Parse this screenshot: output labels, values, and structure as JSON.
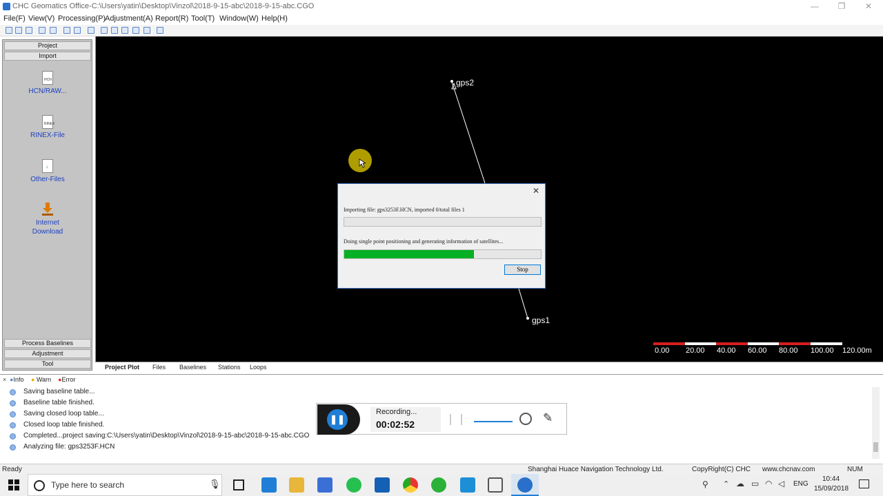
{
  "window": {
    "title": "CHC Geomatics Office-C:\\Users\\yatin\\Desktop\\Vinzol\\2018-9-15-abc\\2018-9-15-abc.CGO",
    "controls": {
      "minimize": "—",
      "maximize": "❐",
      "close": "✕"
    }
  },
  "menu": [
    "File(F)",
    "View(V)",
    "Processing(P)",
    "Adjustment(A)",
    "Report(R)",
    "Tool(T)",
    "Window(W)",
    "Help(H)"
  ],
  "left_panel": {
    "top_headers": [
      "Project",
      "Import"
    ],
    "items": [
      {
        "label": "HCN/RAW...",
        "tag": "HCN"
      },
      {
        "label": "RINEX-File",
        "tag": "RINEX"
      },
      {
        "label": "Other-Files",
        "tag": ""
      },
      {
        "label_line1": "Internet",
        "label_line2": "Download"
      }
    ],
    "bottom_headers": [
      "Process Baselines",
      "Adjustment",
      "Tool"
    ]
  },
  "map": {
    "stations": [
      {
        "name": "gps2"
      },
      {
        "name": "gps1"
      }
    ],
    "scale_labels": [
      "0.00",
      "20.00",
      "40.00",
      "60.00",
      "80.00",
      "100.00",
      "120.00m"
    ],
    "scale_colors": [
      "#d81e1e",
      "#ffffff"
    ]
  },
  "tabs": [
    "Project Plot",
    "Files",
    "Baselines",
    "Stations",
    "Loops"
  ],
  "dialog": {
    "import_status": "Importing file: gps3253F.HCN, imported 0/total files 1",
    "import_progress": 0,
    "spp_status": "Doing single point positioning and generating information of satellites...",
    "spp_progress": 0.66,
    "stop_label": "Stop",
    "close": "✕"
  },
  "log": {
    "tabs": [
      "Info",
      "Warn",
      "Error"
    ],
    "lines": [
      "Saving baseline table...",
      "Baseline table finished.",
      "Saving closed loop table...",
      "Closed loop table finished.",
      "Completed...project saving:C:\\Users\\yatin\\Desktop\\Vinzol\\2018-9-15-abc\\2018-9-15-abc.CGO",
      "Analyzing file: gps3253F.HCN"
    ]
  },
  "recorder": {
    "status": "Recording...",
    "time": "00:02:52"
  },
  "statusbar": {
    "left": "Ready",
    "company": "Shanghai Huace Navigation Technology Ltd.",
    "copyright": "CopyRight(C) CHC",
    "website": "www.chcnav.com",
    "numlock": "NUM"
  },
  "taskbar": {
    "search_placeholder": "Type here to search",
    "lang": "ENG",
    "time": "10:44",
    "date": "15/09/2018"
  },
  "colors": {
    "accent": "#0078d7",
    "progress": "#06b025",
    "panel": "#c4c4c4"
  }
}
